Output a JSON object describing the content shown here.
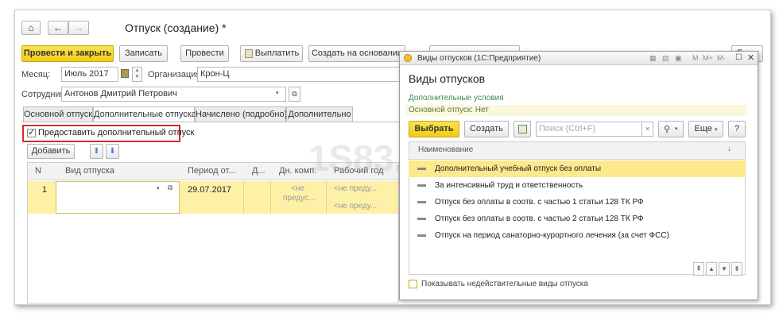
{
  "window": {
    "title": "Отпуск (создание) *",
    "home_label": "⌂",
    "back_label": "←",
    "forward_label": "→"
  },
  "toolbar": {
    "post_close": "Провести и закрыть",
    "save": "Записать",
    "post": "Провести",
    "pay": "Выплатить",
    "create_based": "Создать на основании",
    "partial_hidden": "...",
    "partial_right": "Е"
  },
  "form": {
    "month_label": "Месяц:",
    "month_value": "Июль 2017",
    "org_label": "Организация:",
    "org_value": "Крон-Ц",
    "employee_label": "Сотрудник:",
    "employee_value": "Антонов Дмитрий Петрович"
  },
  "tabs": [
    "Основной отпуск",
    "Дополнительные отпуска",
    "Начислено (подробно)",
    "Дополнительно"
  ],
  "checkbox": {
    "label": "Предоставить дополнительный отпуск",
    "checked": true
  },
  "add_button": "Добавить",
  "table": {
    "headers": [
      "N",
      "Вид отпуска",
      "Период от...",
      "Д...",
      "Дн. комп.",
      "Рабочий год"
    ],
    "row": {
      "n": "1",
      "type": "",
      "period": "29.07.2017",
      "days": "",
      "comp_1": "<не",
      "comp_2": "предус...",
      "year_1": "<не преду...",
      "year_2": "<не преду..."
    }
  },
  "watermark": "1S83.info",
  "dialog": {
    "title": "Виды отпусков (1С:Предприятие)",
    "heading": "Виды отпусков",
    "extra_conditions": "Дополнительные условия",
    "main_leave_status": "Основной отпуск: Нет",
    "select": "Выбрать",
    "create": "Создать",
    "search_placeholder": "Поиск (Ctrl+F)",
    "more": "Еще",
    "help": "?",
    "column_header": "Наименование",
    "sort_icon": "↓",
    "items": [
      "Дополнительный учебный отпуск без оплаты",
      "За интенсивный труд и ответственность",
      "Отпуск без оплаты в соотв. с частью 1 статьи 128 ТК РФ",
      "Отпуск без оплаты в соотв. с частью 2 статьи 128 ТК РФ",
      "Отпуск на период санаторно-курортного лечения (за счет ФСС)"
    ],
    "show_invalid": "Показывать недействительные виды отпуска",
    "win_controls": [
      "M",
      "M+",
      "M-"
    ]
  },
  "colors": {
    "accent_yellow": "#f4d02a",
    "row_highlight": "#fdf1a8",
    "selected_row": "#fbe98c",
    "green_link": "#3a8a4d",
    "red_frame": "#d62b2b"
  }
}
